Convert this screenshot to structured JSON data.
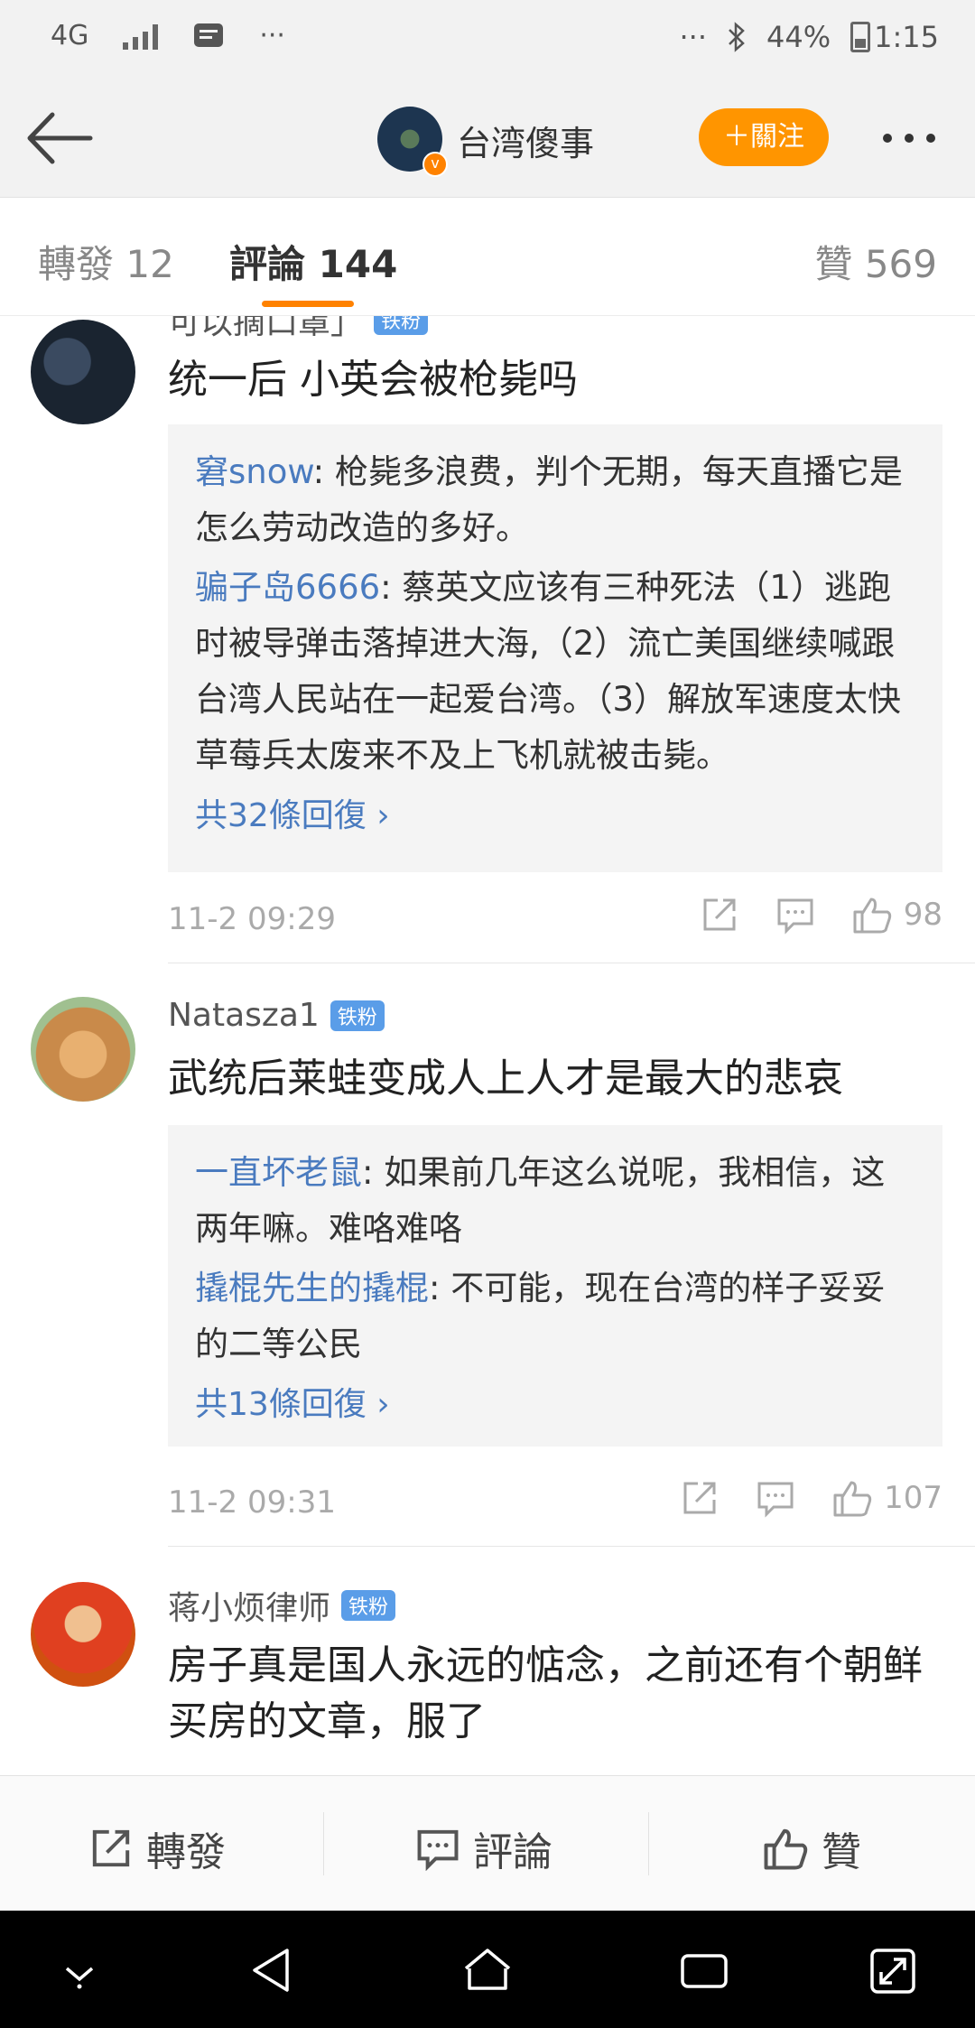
{
  "status_bar": {
    "network": "4G",
    "more_left": "···",
    "more_right": "···",
    "battery": "44%",
    "time": "1:15"
  },
  "nav": {
    "title": "台湾傻事",
    "follow_label": "＋關注"
  },
  "tabs": {
    "repost": "轉發 12",
    "comments": "評論 144",
    "likes": "贊 569"
  },
  "comments": [
    {
      "username": "可以摘口罩」",
      "badge": "铁粉",
      "text": "统一后 小英会被枪毙吗",
      "replies": [
        {
          "user": "窘snow",
          "text": ": 枪毙多浪费，判个无期，每天直播它是怎么劳动改造的多好。"
        },
        {
          "user": "骗子岛6666",
          "text": ": 蔡英文应该有三种死法（1）逃跑时被导弹击落掉进大海,（2）流亡美国继续喊跟台湾人民站在一起爱台湾。（3）解放军速度太快草莓兵太废来不及上飞机就被击毙。"
        }
      ],
      "more_replies": "共32條回復 ›",
      "time": "11-2 09:29",
      "likes": "98"
    },
    {
      "username": "Natasza1",
      "badge": "铁粉",
      "text": "武统后莱蛙变成人上人才是最大的悲哀",
      "replies": [
        {
          "user": "一直坏老鼠",
          "text": ": 如果前几年这么说呢，我相信，这两年嘛。难咯难咯"
        },
        {
          "user": "撬棍先生的撬棍",
          "text": ": 不可能，现在台湾的样子妥妥的二等公民"
        }
      ],
      "more_replies": "共13條回復 ›",
      "time": "11-2 09:31",
      "likes": "107"
    },
    {
      "username": "蒋小烦律师",
      "badge": "铁粉",
      "text": "房子真是国人永远的惦念，之前还有个朝鲜买房的文章，服了"
    }
  ],
  "action_bar": {
    "repost": "轉發",
    "comment": "評論",
    "like": "贊"
  },
  "colors": {
    "accent": "#ff8200",
    "link": "#4a7bbf",
    "badge": "#5a9de8"
  }
}
